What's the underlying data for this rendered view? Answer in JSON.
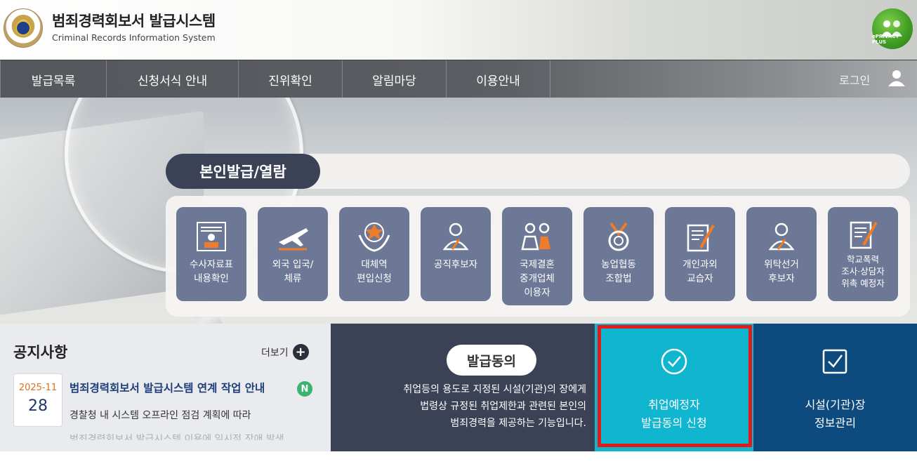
{
  "header": {
    "title": "범죄경력회보서 발급시스템",
    "subtitle": "Criminal Records Information System",
    "eprivacy_label": "ePRIVACY PLUS"
  },
  "nav": {
    "items": [
      {
        "label": "발급목록"
      },
      {
        "label": "신청서식 안내"
      },
      {
        "label": "진위확인"
      },
      {
        "label": "알림마당"
      },
      {
        "label": "이용안내"
      }
    ],
    "login": "로그인"
  },
  "hero": {
    "section_title": "본인발급/열람",
    "cards": [
      {
        "label": "수사자료표\n내용확인",
        "icon": "record-icon"
      },
      {
        "label": "외국 입국/\n체류",
        "icon": "airplane-icon"
      },
      {
        "label": "대체역\n편입신청",
        "icon": "emblem-icon"
      },
      {
        "label": "공직후보자",
        "icon": "person-icon"
      },
      {
        "label": "국제결혼\n중개업체\n이용자",
        "icon": "couple-icon"
      },
      {
        "label": "농업협동\n조합법",
        "icon": "medal-icon"
      },
      {
        "label": "개인과외\n교습자",
        "icon": "document-pen-icon"
      },
      {
        "label": "위탁선거\n후보자",
        "icon": "person-icon"
      },
      {
        "label": "학교폭력\n조사·상담자\n위촉 예정자",
        "icon": "document-pen-icon"
      }
    ]
  },
  "notice": {
    "title": "공지사항",
    "more_label": "더보기",
    "items": [
      {
        "date_ym": "2025-11",
        "date_day": "28",
        "headline": "범죄경력회보서 발급시스템 연계 작업 안내",
        "badge": "N",
        "body": "경찰청 내 시스템 오프라인 점검 계획에 따라",
        "body_more": "범죄경력회보서 발급시스템 이용에 일시적 장애 발생"
      }
    ]
  },
  "consent": {
    "title": "발급동의",
    "description_lines": [
      "취업등의 용도로 지정된 시설(기관)의 장에게",
      "법령상 규정된 취업제한과 관련된 본인의",
      "범죄경력을 제공하는 기능입니다."
    ]
  },
  "actions": {
    "apply_label_line1": "취업예정자",
    "apply_label_line2": "발급동의 신청",
    "facility_label_line1": "시설(기관)장",
    "facility_label_line2": "정보관리"
  },
  "colors": {
    "nav_bg": "#5b5e62",
    "card_bg": "#6c7895",
    "pill_title_bg": "#3b4255",
    "apply_bg": "#10b6cf",
    "facility_bg": "#0d4a7e",
    "highlight": "#e31a1a",
    "card_accent": "#f07c2a"
  }
}
